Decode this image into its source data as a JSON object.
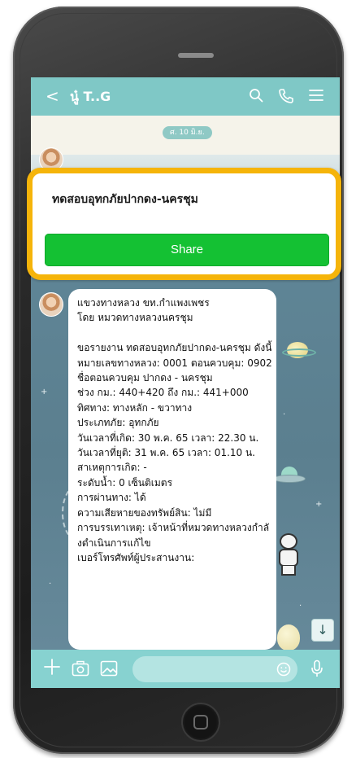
{
  "header": {
    "back_glyph": "<",
    "chat_name": "นู๋ T..G"
  },
  "date_badge": "ศ. 10 มิ.ย.",
  "share_card": {
    "title": "ทดสอบอุทกภัยปากดง-นครชุม",
    "button_label": "Share",
    "highlight_color": "#f5b40a",
    "button_color": "#14c133"
  },
  "message": {
    "text": "แขวงทางหลวง ขท.กำแพงเพชร\nโดย หมวดทางหลวงนครชุม\n\nขอรายงาน ทดสอบอุทกภัยปากดง-นครชุม ดังนี้\nหมายเลขทางหลวง: 0001 ตอนควบคุม: 0902\nชื่อตอนควบคุม ปากดง - นครชุม\nช่วง กม.: 440+420 ถึง กม.: 441+000\nทิศทาง: ทางหลัก - ขวาทาง\nประเภทภัย: อุทกภัย\nวันเวลาที่เกิด: 30 พ.ค. 65 เวลา: 22.30 น.\nวันเวลาที่ยุติ: 31 พ.ค. 65 เวลา: 01.10 น.\nสาเหตุการเกิด: -\nระดับน้ำ: 0 เซ็นติเมตร\nการผ่านทาง: ได้\nความเสียหายของทรัพย์สิน: ไม่มี\nการบรรเทาเหตุ: เจ้าหน้าที่หมวดทางหลวงกำลังดำเนินการแก้ไข\nเบอร์โทรศัพท์ผู้ประสานงาน:"
  },
  "scroll_down_glyph": "↓",
  "icons": [
    "back-icon",
    "search-icon",
    "call-icon",
    "menu-icon",
    "plus-icon",
    "camera-icon",
    "image-icon",
    "emoji-icon",
    "mic-icon",
    "arrow-down-icon"
  ],
  "colors": {
    "header": "#7fc8c6",
    "input_bar": "#87d2d0"
  }
}
